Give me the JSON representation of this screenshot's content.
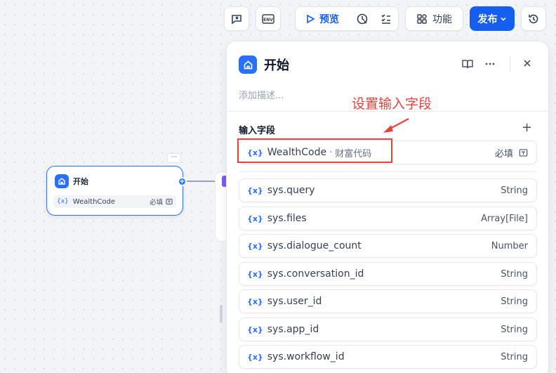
{
  "toolbar": {
    "preview_label": "预览",
    "features_label": "功能",
    "publish_label": "发布",
    "env_label": "ENV"
  },
  "canvas": {
    "node": {
      "title": "开始",
      "var_name": "WealthCode",
      "var_required": "必填",
      "more": "···",
      "handle": "+"
    }
  },
  "panel": {
    "title": "开始",
    "description_placeholder": "添加描述...",
    "section_label": "输入字段",
    "add": "+",
    "input_field": {
      "icon": "{x}",
      "name": "WealthCode",
      "separator": "·",
      "label": "财富代码",
      "required": "必填"
    },
    "system_vars": [
      {
        "icon": "{x}",
        "name": "sys.query",
        "type": "String"
      },
      {
        "icon": "{x}",
        "name": "sys.files",
        "type": "Array[File]"
      },
      {
        "icon": "{x}",
        "name": "sys.dialogue_count",
        "type": "Number"
      },
      {
        "icon": "{x}",
        "name": "sys.conversation_id",
        "type": "String"
      },
      {
        "icon": "{x}",
        "name": "sys.user_id",
        "type": "String"
      },
      {
        "icon": "{x}",
        "name": "sys.app_id",
        "type": "String"
      },
      {
        "icon": "{x}",
        "name": "sys.workflow_id",
        "type": "String"
      }
    ]
  },
  "annotation": {
    "text": "设置输入字段",
    "color": "#e5443a"
  },
  "colors": {
    "primary": "#155eef",
    "accent": "#2970ff"
  }
}
